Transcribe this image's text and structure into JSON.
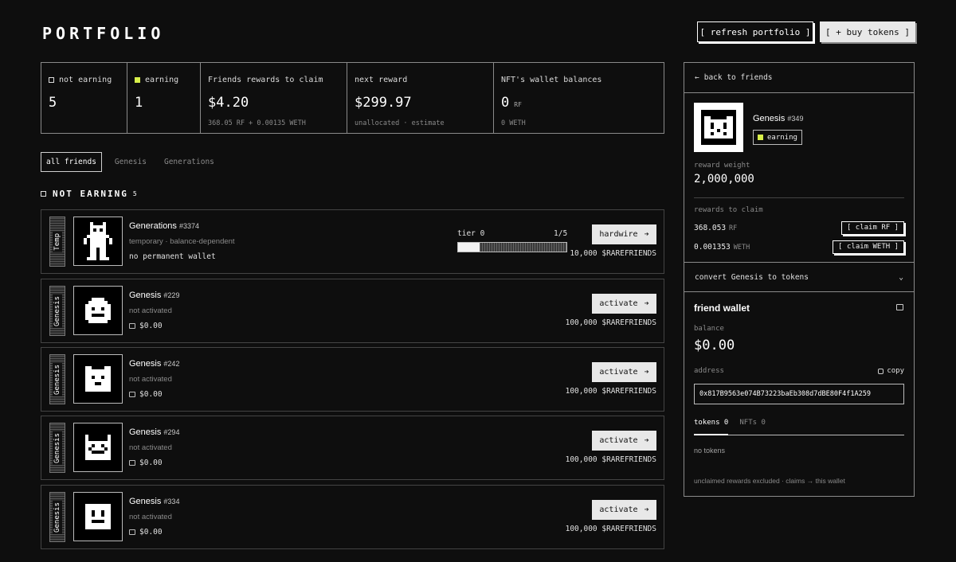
{
  "header": {
    "title": "PORTFOLIO",
    "refresh_label": "[ refresh portfolio ]",
    "buy_label": "[ + buy tokens ]"
  },
  "stats": [
    {
      "label": "not earning",
      "value": "5",
      "sub": ""
    },
    {
      "label": "earning",
      "value": "1",
      "sub": ""
    },
    {
      "label": "Friends rewards to claim",
      "value": "$4.20",
      "sub": "368.05 RF + 0.00135 WETH"
    },
    {
      "label": "next reward",
      "value": "$299.97",
      "sub": "unallocated · estimate"
    },
    {
      "label": "NFT's wallet balances",
      "value": "0",
      "unit": "RF",
      "sub": "0 WETH"
    }
  ],
  "tabs": [
    "all friends",
    "Genesis",
    "Generations"
  ],
  "section": {
    "title": "NOT EARNING",
    "count": "5"
  },
  "rows": [
    {
      "tag": "Temp",
      "name": "Generations",
      "num": "#3374",
      "status": "temporary · balance-dependent",
      "line3": "no permanent wallet",
      "button": "hardwire",
      "amount": "10,000 $RAREFRIENDS",
      "tier_label": "tier 0",
      "tier_frac": "1/5",
      "tier_progress": 0.2
    },
    {
      "tag": "Genesis",
      "name": "Genesis",
      "num": "#229",
      "status": "not activated",
      "line3": "$0.00",
      "button": "activate",
      "amount": "100,000 $RAREFRIENDS"
    },
    {
      "tag": "Genesis",
      "name": "Genesis",
      "num": "#242",
      "status": "not activated",
      "line3": "$0.00",
      "button": "activate",
      "amount": "100,000 $RAREFRIENDS"
    },
    {
      "tag": "Genesis",
      "name": "Genesis",
      "num": "#294",
      "status": "not activated",
      "line3": "$0.00",
      "button": "activate",
      "amount": "100,000 $RAREFRIENDS"
    },
    {
      "tag": "Genesis",
      "name": "Genesis",
      "num": "#334",
      "status": "not activated",
      "line3": "$0.00",
      "button": "activate",
      "amount": "100,000 $RAREFRIENDS"
    }
  ],
  "panel": {
    "back_label": "back to friends",
    "name": "Genesis",
    "num": "#349",
    "badge": "earning",
    "reward_weight_label": "reward weight",
    "reward_weight": "2,000,000",
    "rewards_label": "rewards to claim",
    "rf_amount": "368.053",
    "rf_unit": "RF",
    "claim_rf": "[ claim RF ]",
    "weth_amount": "0.001353",
    "weth_unit": "WETH",
    "claim_weth": "[ claim WETH ]",
    "convert_label": "convert Genesis to tokens",
    "wallet_title": "friend wallet",
    "balance_label": "balance",
    "balance": "$0.00",
    "address_label": "address",
    "copy_label": "copy",
    "address": "0x817B9563e074B73223baEb308d7dBE80F4f1A259",
    "tokens_tab": "tokens 0",
    "nfts_tab": "NFTs 0",
    "no_tokens": "no tokens",
    "footer": "unclaimed rewards excluded · claims → this wallet"
  },
  "colors": {
    "accent": "#d8f04a",
    "bg": "#0e0e0e",
    "border": "#8a8a8a"
  }
}
